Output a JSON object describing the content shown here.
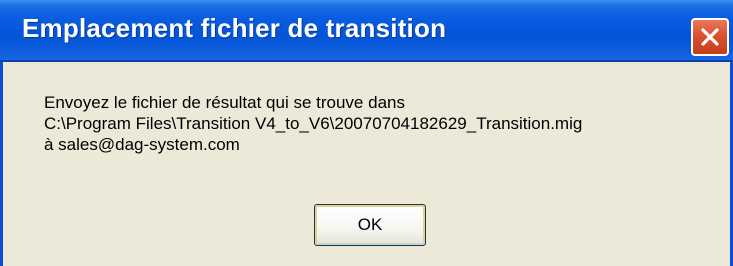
{
  "window": {
    "title": "Emplacement fichier de transition",
    "close_icon": "close-x-icon"
  },
  "message": {
    "line1": "Envoyez le fichier de résultat qui se trouve dans",
    "line2": "C:\\Program Files\\Transition V4_to_V6\\20070704182629_Transition.mig",
    "line3": "à sales@dag-system.com"
  },
  "buttons": {
    "ok_label": "OK"
  },
  "colors": {
    "titlebar": "#0a5ce0",
    "close_button": "#d9532f",
    "dialog_background": "#ece9d8"
  }
}
